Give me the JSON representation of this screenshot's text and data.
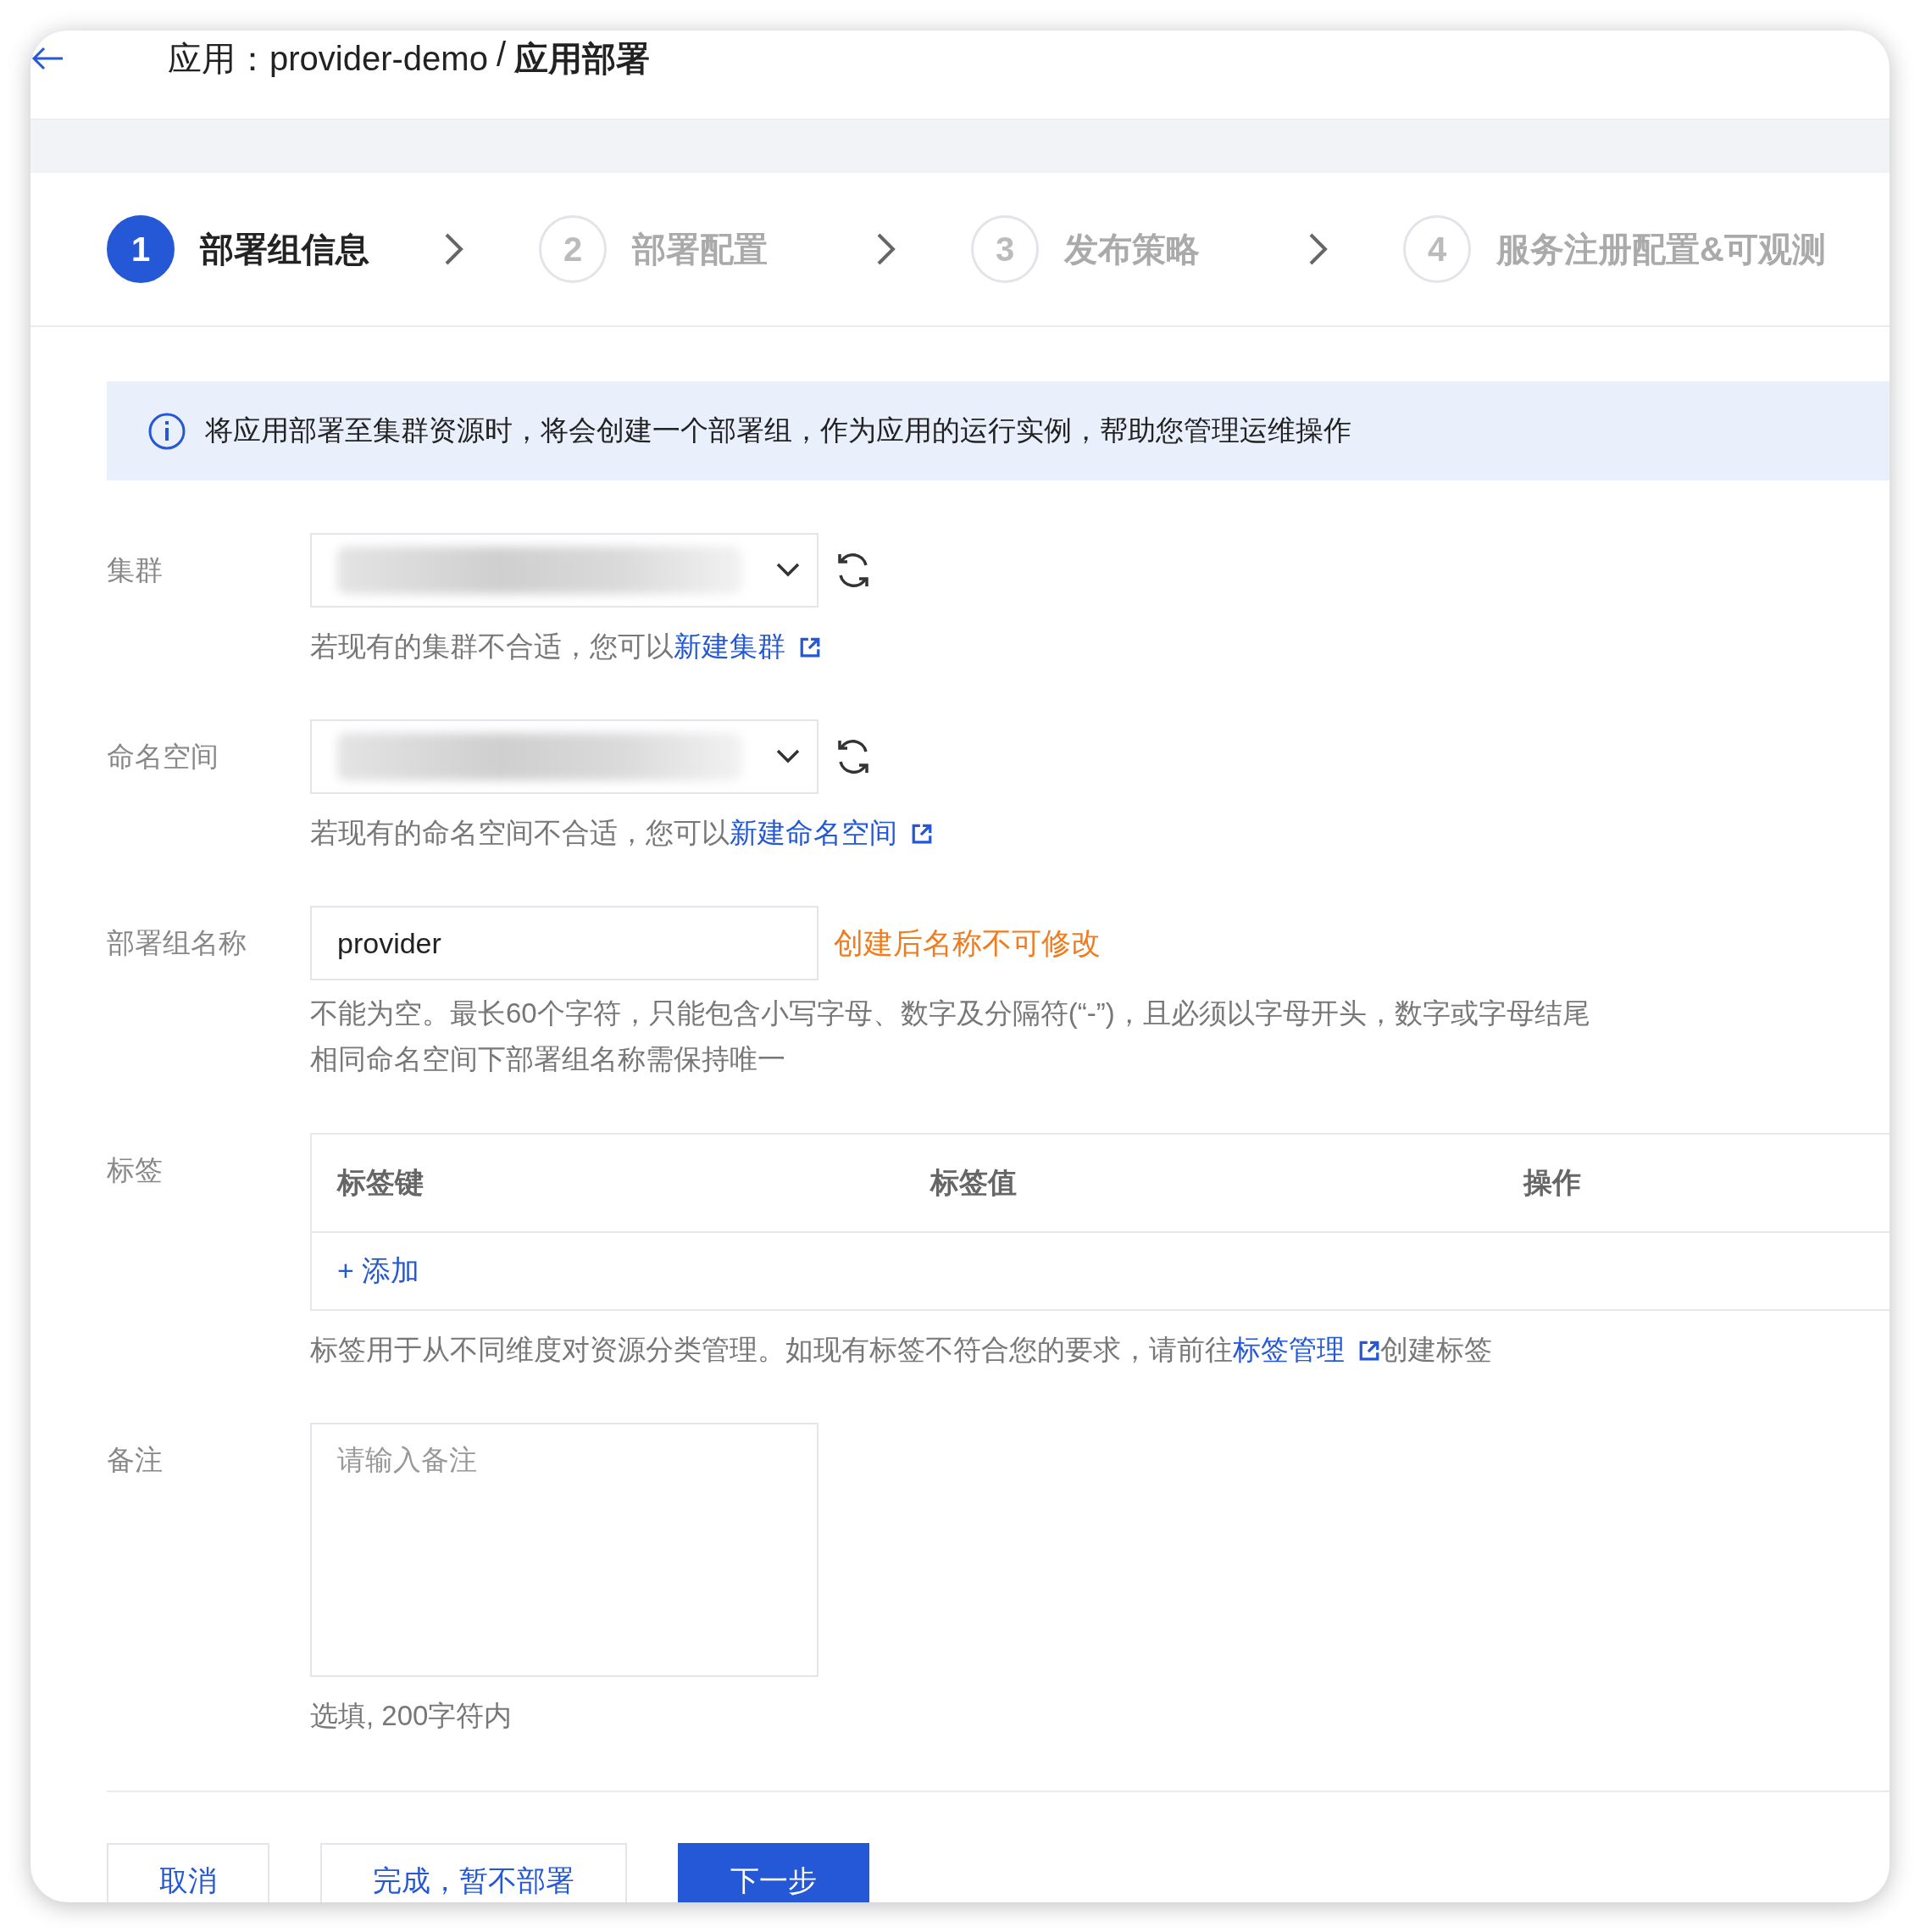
{
  "header": {
    "app_label": "应用：provider-demo",
    "separator": "/",
    "current": "应用部署"
  },
  "steps": [
    {
      "number": "1",
      "label": "部署组信息",
      "selected": true
    },
    {
      "number": "2",
      "label": "部署配置",
      "selected": false
    },
    {
      "number": "3",
      "label": "发布策略",
      "selected": false
    },
    {
      "number": "4",
      "label": "服务注册配置&可观测",
      "selected": false
    }
  ],
  "notice": {
    "text": "将应用部署至集群资源时，将会创建一个部署组，作为应用的运行实例，帮助您管理运维操作"
  },
  "fields": [
    {
      "kind": "select",
      "label": "集群",
      "hint": "若现有的集群不合适，您可以",
      "hint_link": "新建集群"
    },
    {
      "kind": "select",
      "label": "命名空间",
      "hint": "若现有的命名空间不合适，您可以",
      "hint_link": "新建命名空间"
    },
    {
      "kind": "input",
      "label": "部署组名称",
      "value": "provider",
      "warning": "创建后名称不可修改",
      "hints": [
        "不能为空。最长60个字符，只能包含小写字母、数字及分隔符(“-”)，且必须以字母开头，数字或字母结尾",
        "相同命名空间下部署组名称需保持唯一"
      ]
    },
    {
      "kind": "table",
      "label": "标签",
      "columns": [
        "标签键",
        "标签值",
        "操作"
      ],
      "add_action": "+ 添加",
      "hint": "标签用于从不同维度对资源分类管理。如现有标签不符合您的要求，请前往",
      "hint_link": "标签管理",
      "hint_suffix": "创建标签"
    },
    {
      "kind": "textarea",
      "label": "备注",
      "placeholder": "请输入备注",
      "hint": "选填, 200字符内"
    }
  ],
  "buttons": [
    {
      "label": "取消",
      "kind": "default"
    },
    {
      "label": "完成，暂不部署",
      "kind": "default"
    },
    {
      "label": "下一步",
      "kind": "primary"
    }
  ]
}
